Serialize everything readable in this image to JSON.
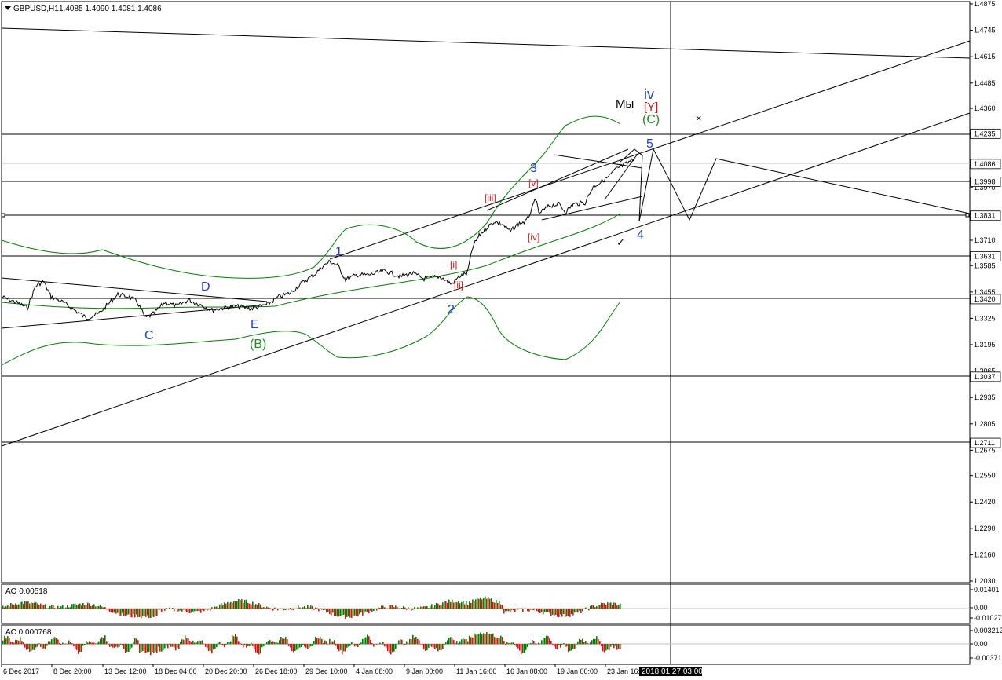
{
  "header": {
    "symbol": "GBPUSD,H1",
    "ohlc": "1.4085 1.4090 1.4081 1.4086"
  },
  "colors": {
    "price": "#000000",
    "band": "#008000",
    "wave_blue": "#1f3fd0",
    "wave_red": "#d01818",
    "wave_green": "#1e8c1e",
    "osc_up": "#008000",
    "osc_down": "#e01010"
  },
  "main_axis": {
    "ticks": [
      "1.4875",
      "1.4745",
      "1.4615",
      "1.4485",
      "1.4360",
      "1.4235",
      "1.3970",
      "1.3840",
      "1.3710",
      "1.3585",
      "1.3455",
      "1.3325",
      "1.3195",
      "1.3065",
      "1.2935",
      "1.2805",
      "1.2675",
      "1.2550",
      "1.2420",
      "1.2290",
      "1.2160",
      "1.2030"
    ],
    "boxed": [
      "1.4235",
      "1.4086",
      "1.3998",
      "1.3831",
      "1.3631",
      "1.3420",
      "1.3037",
      "1.2711"
    ]
  },
  "time_axis": {
    "labels": [
      "6 Dec 2017",
      "8 Dec 20:00",
      "13 Dec 12:00",
      "18 Dec 04:00",
      "20 Dec 20:00",
      "26 Dec 18:00",
      "29 Dec 10:00",
      "4 Jan 08:00",
      "9 Jan 00:00",
      "11 Jan 16:00",
      "16 Jan 08:00",
      "19 Jan 00:00",
      "23 Jan 16:00"
    ],
    "cursor_label": "2018.01.27 03:00"
  },
  "waves": {
    "w1": "1",
    "w2": "2",
    "w3": "3",
    "w4": "4",
    "w5": "5",
    "wC": "C",
    "wD": "D",
    "wE": "E",
    "wB": "(B)",
    "wCC": "(C)",
    "wiv": "iv",
    "wY": "[Y]",
    "wMy": "Мы",
    "ri": "[i]",
    "rii": "[ii]",
    "riii": "[iii]",
    "riv": "[iv]",
    "rv": "[v]",
    "cross": "×",
    "check": "✓"
  },
  "ao_panel": {
    "title": "AO 0.00518",
    "ticks": [
      "0.01401",
      "0.00",
      "-0.01027"
    ]
  },
  "ac_panel": {
    "title": "AC 0.000768",
    "ticks": [
      "0.003212",
      "0.00",
      "-0.00371"
    ]
  }
}
